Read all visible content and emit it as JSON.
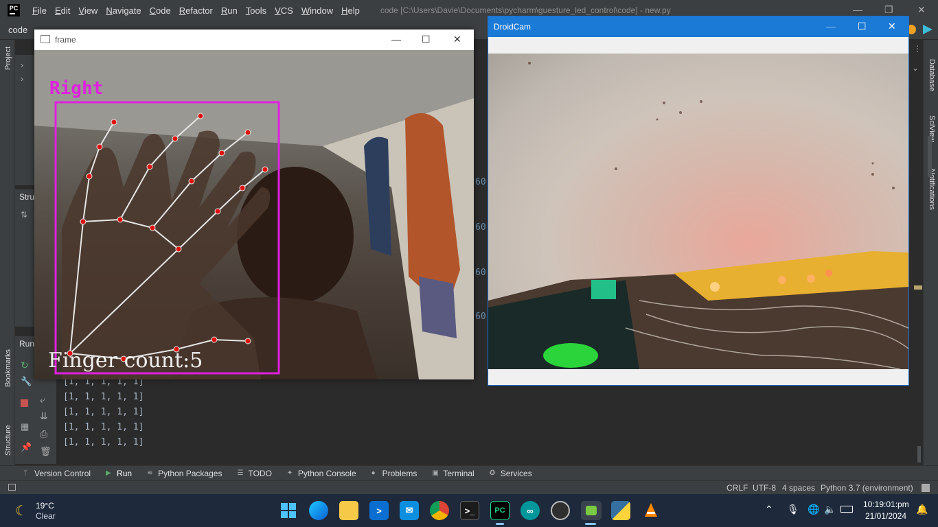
{
  "ide": {
    "logo_text": "PC",
    "menu": [
      "File",
      "Edit",
      "View",
      "Navigate",
      "Code",
      "Refactor",
      "Run",
      "Tools",
      "VCS",
      "Window",
      "Help"
    ],
    "window_title": "code [C:\\Users\\Davie\\Documents\\pycharm\\guesture_led_control\\code] - new.py",
    "breadcrumb": "code",
    "left_labels": {
      "project": "Project",
      "structure_top": "Stru",
      "run": "Run",
      "bookmarks": "Bookmarks",
      "structure": "Structure"
    },
    "right_labels": {
      "database": "Database",
      "sciview": "SciView",
      "notifications": "Notifications"
    },
    "console_lines": [
      "[1, 1, 1, 1, 1]",
      "[1, 1, 1, 1, 1]",
      "[1, 1, 1, 1, 1]",
      "[1, 1, 1, 1, 1]",
      "[1, 1, 1, 1, 1]"
    ],
    "gutter_numbers": [
      "60",
      "60",
      "60",
      "60"
    ],
    "tool_tabs": [
      "Version Control",
      "Run",
      "Python Packages",
      "TODO",
      "Python Console",
      "Problems",
      "Terminal",
      "Services"
    ],
    "status": {
      "line_sep": "CRLF",
      "encoding": "UTF-8",
      "indent": "4 spaces",
      "interpreter": "Python 3.7 (environment)"
    }
  },
  "frame_window": {
    "title": "frame",
    "hand_label": "Right",
    "finger_count_text": "Finger count:5",
    "accent_color": "#e020e0"
  },
  "droidcam_window": {
    "title": "DroidCam",
    "title_color": "#1b7ad6"
  },
  "taskbar": {
    "weather_temp": "19°C",
    "weather_desc": "Clear",
    "time": "10:19:01:pm",
    "date": "21/01/2024"
  }
}
